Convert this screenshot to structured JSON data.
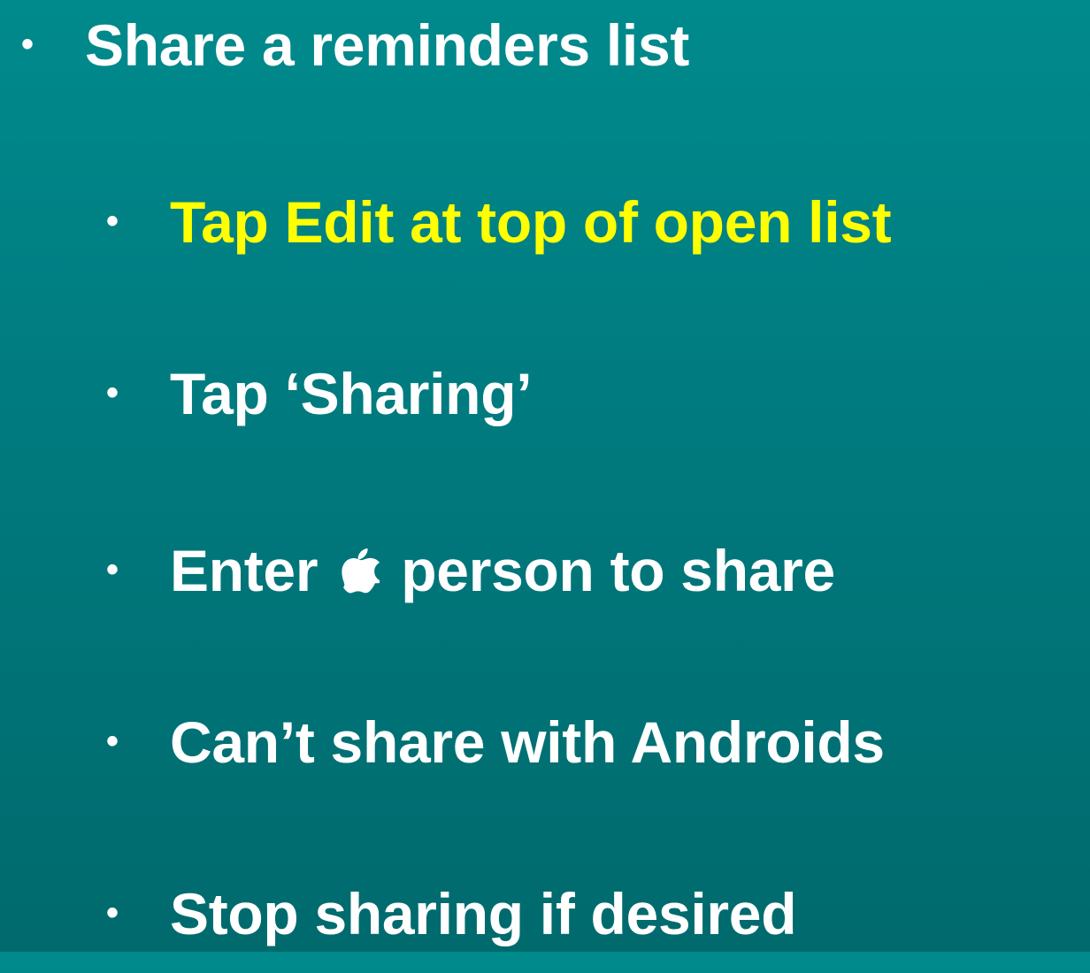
{
  "slide": {
    "heading": {
      "bullet": "•",
      "text": "Share a reminders list"
    },
    "items": [
      {
        "bullet": "•",
        "text": "Tap Edit at top of open list",
        "color": "#ffff00"
      },
      {
        "bullet": "•",
        "text": "Tap ‘Sharing’",
        "color": "#ffffff"
      },
      {
        "bullet": "•",
        "text_before": "Enter",
        "icon": "apple-logo-icon",
        "text_after": "person to share",
        "color": "#ffffff"
      },
      {
        "bullet": "•",
        "text": "Can’t share with Androids",
        "color": "#ffffff"
      },
      {
        "bullet": "•",
        "text": "Stop sharing if desired",
        "color": "#ffffff"
      }
    ]
  },
  "colors": {
    "background_top": "#008a8c",
    "background_bottom": "#006a6d",
    "highlight": "#ffff00",
    "text": "#ffffff"
  }
}
